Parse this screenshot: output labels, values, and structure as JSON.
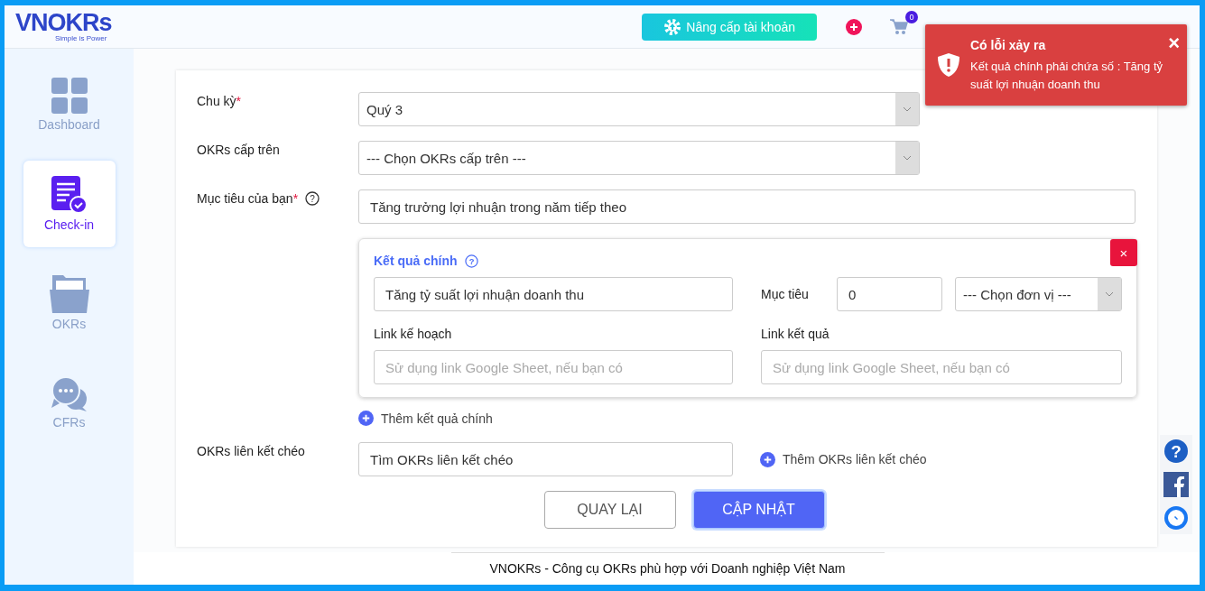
{
  "header": {
    "logo_text": "VNOKRs",
    "logo_tagline": "Simple is Power",
    "upgrade_button": "Nâng cấp tài khoản",
    "cart_badge": "0"
  },
  "sidebar": {
    "items": [
      {
        "label": "Dashboard",
        "kind": "dashboard",
        "selected": false
      },
      {
        "label": "Check-in",
        "kind": "checkin",
        "selected": true
      },
      {
        "label": "OKRs",
        "kind": "okrs",
        "selected": false
      },
      {
        "label": "CFRs",
        "kind": "cfrs",
        "selected": false
      }
    ]
  },
  "form": {
    "cycle": {
      "label": "Chu kỳ",
      "required_mark": "*",
      "value": "Quý 3"
    },
    "parent_okrs": {
      "label": "OKRs cấp trên",
      "value": "--- Chọn OKRs cấp trên ---"
    },
    "objective": {
      "label": "Mục tiêu của bạn",
      "required_mark": "*",
      "help_icon": "?",
      "value": "Tăng trưởng lợi nhuận trong năm tiếp theo"
    },
    "key_result": {
      "title": "Kết quả chính",
      "help_icon": "?",
      "value": "Tăng tỷ suất lợi nhuận doanh thu",
      "target_label": "Mục tiêu",
      "target_value": "0",
      "unit_value": "--- Chọn đơn vị ---",
      "plan_link_label": "Link kế hoạch",
      "plan_link_placeholder": "Sử dụng link Google Sheet, nếu bạn có",
      "result_link_label": "Link kết quả",
      "result_link_placeholder": "Sử dụng link Google Sheet, nếu bạn có",
      "close_button": "×"
    },
    "add_key_result": "Thêm kết quả chính",
    "cross_links": {
      "label": "OKRs liên kết chéo",
      "placeholder": "Tìm OKRs liên kết chéo",
      "add": "Thêm OKRs liên kết chéo"
    },
    "buttons": [
      {
        "label": "QUAY LẠI",
        "kind": "secondary"
      },
      {
        "label": "CẬP NHẬT",
        "kind": "primary"
      }
    ]
  },
  "help_button": "?",
  "footer": "VNOKRs - Công cụ OKRs phù hợp với Doanh nghiệp Việt Nam",
  "toast": {
    "title": "Có lỗi xảy ra",
    "message": "Kết quả chính phải chứa số : Tăng tỷ suất lợi nhuận doanh thu",
    "close": "×"
  }
}
